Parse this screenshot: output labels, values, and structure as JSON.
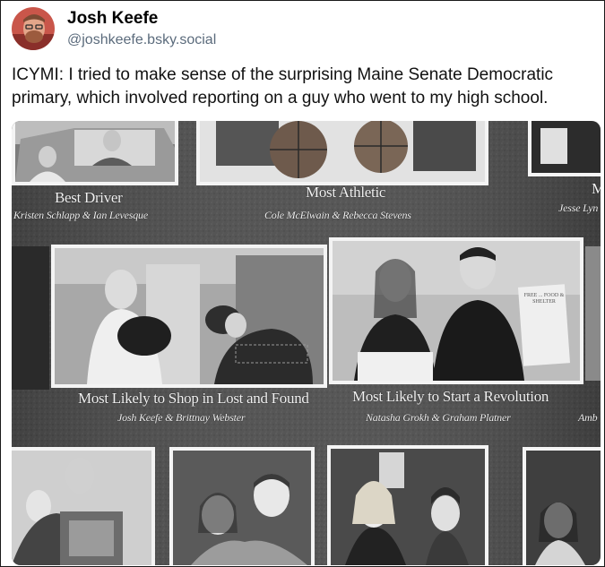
{
  "post": {
    "display_name": "Josh Keefe",
    "handle": "@joshkeefe.bsky.social",
    "text": "ICYMI: I tried to make sense of the surprising Maine Senate Democratic primary, which involved reporting on a guy who went to my high school."
  },
  "yearbook": {
    "captions": [
      {
        "title": "Best Driver",
        "names": "Kristen Schlapp & Ian Levesque"
      },
      {
        "title": "Most Athletic",
        "names": "Cole McElwain & Rebecca Stevens"
      },
      {
        "title": "M",
        "names": "Jesse Lyn"
      },
      {
        "title": "Most Likely to Shop in Lost and Found",
        "names": "Josh Keefe & Brittnay Webster"
      },
      {
        "title": "Most Likely to Start a Revolution",
        "names": "Natasha Grokh & Graham Platner"
      },
      {
        "title": "",
        "names": "Amb"
      }
    ],
    "sign_text": "FREE ... FOOD & SHELTER"
  }
}
